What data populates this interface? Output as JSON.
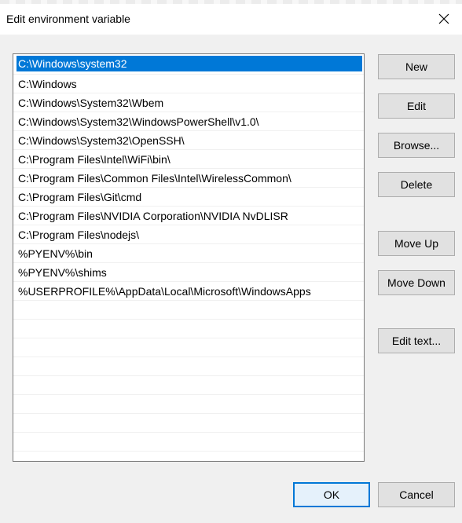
{
  "window": {
    "title": "Edit environment variable"
  },
  "variables": [
    "C:\\Windows\\system32",
    "C:\\Windows",
    "C:\\Windows\\System32\\Wbem",
    "C:\\Windows\\System32\\WindowsPowerShell\\v1.0\\",
    "C:\\Windows\\System32\\OpenSSH\\",
    "C:\\Program Files\\Intel\\WiFi\\bin\\",
    "C:\\Program Files\\Common Files\\Intel\\WirelessCommon\\",
    "C:\\Program Files\\Git\\cmd",
    "C:\\Program Files\\NVIDIA Corporation\\NVIDIA NvDLISR",
    "C:\\Program Files\\nodejs\\",
    "%PYENV%\\bin",
    "%PYENV%\\shims",
    "%USERPROFILE%\\AppData\\Local\\Microsoft\\WindowsApps"
  ],
  "selected_index": 0,
  "buttons": {
    "new": "New",
    "edit": "Edit",
    "browse": "Browse...",
    "delete": "Delete",
    "move_up": "Move Up",
    "move_down": "Move Down",
    "edit_text": "Edit text...",
    "ok": "OK",
    "cancel": "Cancel"
  },
  "icons": {
    "close": "close-icon"
  },
  "colors": {
    "selection": "#0078d7",
    "dialog_bg": "#f0f0f0",
    "button_bg": "#e1e1e1"
  }
}
